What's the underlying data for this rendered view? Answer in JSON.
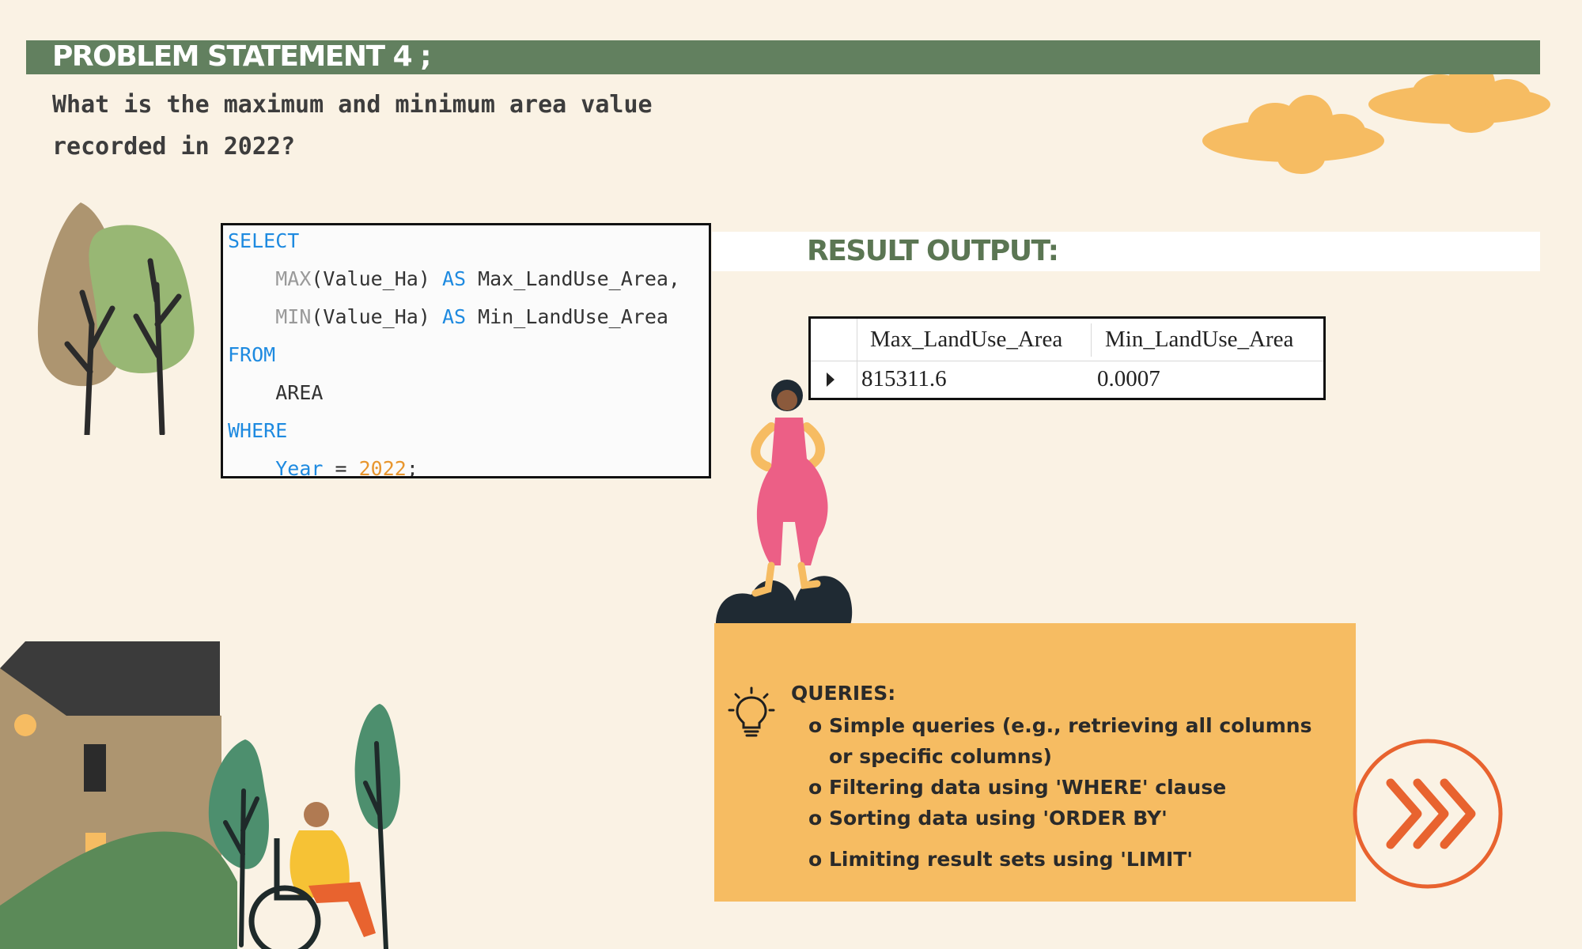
{
  "header": {
    "title": "PROBLEM STATEMENT 4 ;"
  },
  "question": {
    "text": "What is the maximum and minimum area value recorded in 2022?"
  },
  "sql": {
    "l1_kw": "SELECT",
    "l2_fn": "MAX",
    "l2_rest": "(Value_Ha) ",
    "l2_kw": "AS",
    "l2_alias": " Max_LandUse_Area,",
    "l3_fn": "MIN",
    "l3_rest": "(Value_Ha) ",
    "l3_kw": "AS",
    "l3_alias": " Min_LandUse_Area",
    "l4_kw": "FROM",
    "l5_table": "AREA",
    "l6_kw": "WHERE",
    "l7_col": "Year",
    "l7_op": " = ",
    "l7_num": "2022",
    "l7_end": ";"
  },
  "result": {
    "title": "RESULT OUTPUT:",
    "columns": [
      "Max_LandUse_Area",
      "Min_LandUse_Area"
    ],
    "rows": [
      [
        "815311.6",
        "0.0007"
      ]
    ]
  },
  "queries": {
    "title": "QUERIES:",
    "bullet": "o",
    "items": [
      "Simple queries (e.g., retrieving all columns or specific columns)",
      "Filtering data using 'WHERE' clause",
      "Sorting data using 'ORDER BY'",
      "Limiting result sets using 'LIMIT'"
    ]
  },
  "colors": {
    "background": "#faf2e4",
    "header_green": "#62805f",
    "panel_orange": "#f6bc62",
    "accent_orange": "#e8632f",
    "sql_keyword": "#1e8ae0"
  },
  "icons": [
    "lightbulb-icon",
    "next-arrows-icon",
    "row-pointer-icon"
  ]
}
